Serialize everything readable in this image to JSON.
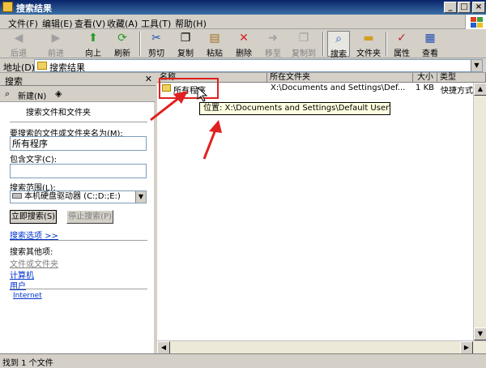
{
  "window": {
    "title": "搜索结果"
  },
  "menu": [
    "文件(F)",
    "编辑(E)",
    "查看(V)",
    "收藏(A)",
    "工具(T)",
    "帮助(H)"
  ],
  "toolbar": {
    "back": "后退",
    "forward": "前进",
    "up": "向上",
    "refresh": "刷新",
    "cut": "剪切",
    "copy": "复制",
    "paste": "粘贴",
    "delete": "删除",
    "moveto": "移至",
    "copyto": "复制到",
    "search": "搜索",
    "folders": "文件夹",
    "properties": "属性",
    "views": "查看"
  },
  "address": {
    "label": "地址(D)",
    "value": "搜索结果"
  },
  "search_pane": {
    "title": "搜索",
    "new_label": "新建(N)",
    "heading": "搜索文件和文件夹",
    "name_label": "要搜索的文件或文件夹名为(M):",
    "name_value": "所有程序",
    "text_label": "包含文字(C):",
    "text_value": "",
    "scope_label": "搜索范围(L):",
    "scope_value": "本机硬盘驱动器 (C:;D:;E:)",
    "search_now": "立即搜索(S)",
    "stop": "停止搜索(P)",
    "options": "搜索选项 >>",
    "other_label": "搜索其他项:",
    "other_items": [
      "文件或文件夹",
      "计算机",
      "用户"
    ],
    "internet": "Internet"
  },
  "columns": [
    "名称",
    "所在文件夹",
    "大小",
    "类型"
  ],
  "results": [
    {
      "name": "所有程序",
      "folder": "X:\\Documents and Settings\\Def...",
      "size": "1 KB",
      "type": "快捷方式"
    }
  ],
  "tooltip": "位置: X:\\Documents and Settings\\Default User\\「开始」菜单",
  "status": "找到 1 个文件",
  "colors": {
    "accent_red": "#e02020",
    "titlebar": "#0a246a",
    "link": "#0033cc"
  }
}
